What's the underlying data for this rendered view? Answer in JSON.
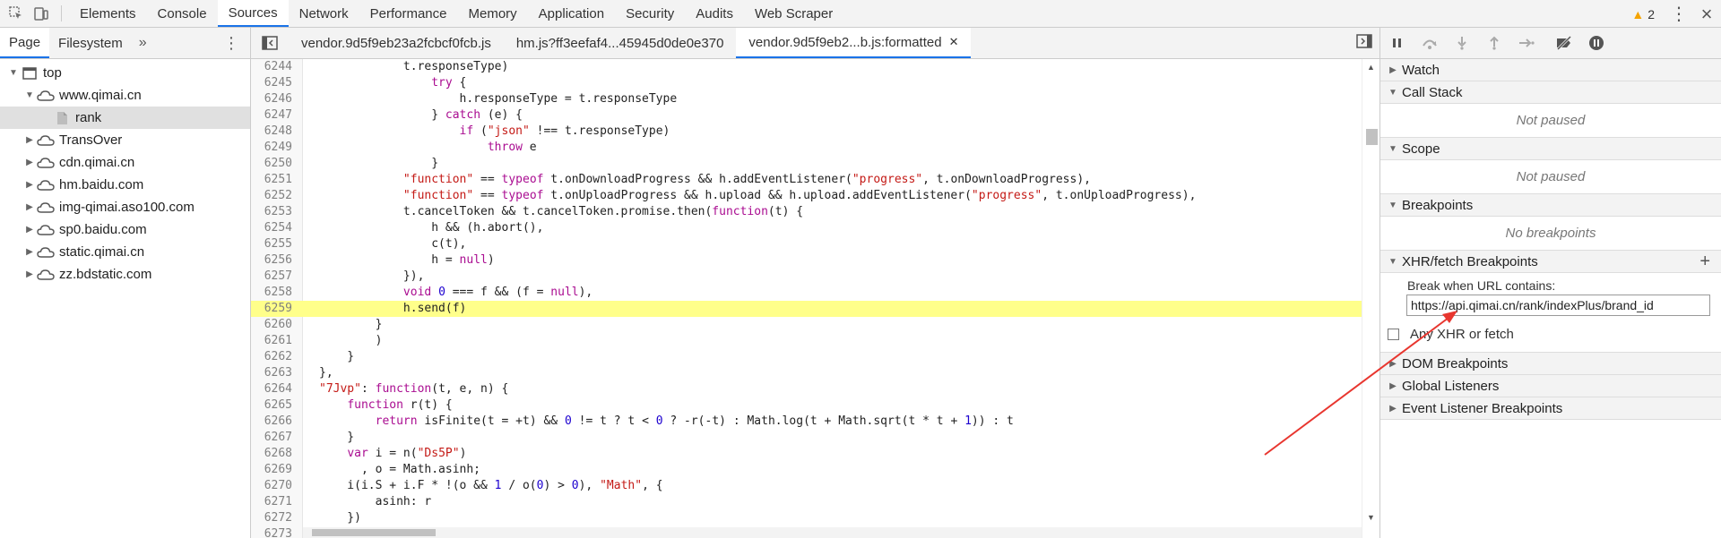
{
  "toolbar": {
    "tabs": [
      "Elements",
      "Console",
      "Sources",
      "Network",
      "Performance",
      "Memory",
      "Application",
      "Security",
      "Audits",
      "Web Scraper"
    ],
    "active_tab": "Sources",
    "warnings_count": "2"
  },
  "navigator": {
    "tabs": [
      "Page",
      "Filesystem"
    ],
    "active_tab": "Page",
    "more": "»",
    "tree": [
      {
        "label": "top",
        "icon": "frame-icon",
        "level": 0,
        "expanded": true
      },
      {
        "label": "www.qimai.cn",
        "icon": "cloud-icon",
        "level": 1,
        "expanded": true
      },
      {
        "label": "rank",
        "icon": "file-icon",
        "level": 2,
        "selected": true
      },
      {
        "label": "TransOver",
        "icon": "cloud-icon",
        "level": 1,
        "expanded": false
      },
      {
        "label": "cdn.qimai.cn",
        "icon": "cloud-icon",
        "level": 1,
        "expanded": false
      },
      {
        "label": "hm.baidu.com",
        "icon": "cloud-icon",
        "level": 1,
        "expanded": false
      },
      {
        "label": "img-qimai.aso100.com",
        "icon": "cloud-icon",
        "level": 1,
        "expanded": false
      },
      {
        "label": "sp0.baidu.com",
        "icon": "cloud-icon",
        "level": 1,
        "expanded": false
      },
      {
        "label": "static.qimai.cn",
        "icon": "cloud-icon",
        "level": 1,
        "expanded": false
      },
      {
        "label": "zz.bdstatic.com",
        "icon": "cloud-icon",
        "level": 1,
        "expanded": false
      }
    ]
  },
  "editor": {
    "tabs": [
      "vendor.9d5f9eb23a2fcbcf0fcb.js",
      "hm.js?ff3eefaf4...45945d0de0e370",
      "vendor.9d5f9eb2...b.js:formatted"
    ],
    "active_tab": "vendor.9d5f9eb2...b.js:formatted",
    "highlighted_line": "6259",
    "lines": [
      {
        "n": "6244",
        "indent": 12,
        "code": "t.responseType)"
      },
      {
        "n": "6245",
        "indent": 16,
        "code": "try {"
      },
      {
        "n": "6246",
        "indent": 20,
        "code": "h.responseType = t.responseType"
      },
      {
        "n": "6247",
        "indent": 16,
        "code": "} catch (e) {"
      },
      {
        "n": "6248",
        "indent": 20,
        "code": "if (\"json\" !== t.responseType)"
      },
      {
        "n": "6249",
        "indent": 24,
        "code": "throw e"
      },
      {
        "n": "6250",
        "indent": 16,
        "code": "}"
      },
      {
        "n": "6251",
        "indent": 12,
        "code": "\"function\" == typeof t.onDownloadProgress && h.addEventListener(\"progress\", t.onDownloadProgress),"
      },
      {
        "n": "6252",
        "indent": 12,
        "code": "\"function\" == typeof t.onUploadProgress && h.upload && h.upload.addEventListener(\"progress\", t.onUploadProgress),"
      },
      {
        "n": "6253",
        "indent": 12,
        "code": "t.cancelToken && t.cancelToken.promise.then(function(t) {"
      },
      {
        "n": "6254",
        "indent": 16,
        "code": "h && (h.abort(),"
      },
      {
        "n": "6255",
        "indent": 16,
        "code": "c(t),"
      },
      {
        "n": "6256",
        "indent": 16,
        "code": "h = null)"
      },
      {
        "n": "6257",
        "indent": 12,
        "code": "}),"
      },
      {
        "n": "6258",
        "indent": 12,
        "code": "void 0 === f && (f = null),"
      },
      {
        "n": "6259",
        "indent": 12,
        "code": "h.send(f)"
      },
      {
        "n": "6260",
        "indent": 8,
        "code": "}"
      },
      {
        "n": "6261",
        "indent": 8,
        "code": ")"
      },
      {
        "n": "6262",
        "indent": 4,
        "code": "}"
      },
      {
        "n": "6263",
        "indent": 0,
        "code": "},"
      },
      {
        "n": "6264",
        "indent": 0,
        "code": "\"7Jvp\": function(t, e, n) {"
      },
      {
        "n": "6265",
        "indent": 4,
        "code": "function r(t) {"
      },
      {
        "n": "6266",
        "indent": 8,
        "code": "return isFinite(t = +t) && 0 != t ? t < 0 ? -r(-t) : Math.log(t + Math.sqrt(t * t + 1)) : t"
      },
      {
        "n": "6267",
        "indent": 4,
        "code": "}"
      },
      {
        "n": "6268",
        "indent": 4,
        "code": "var i = n(\"Ds5P\")"
      },
      {
        "n": "6269",
        "indent": 6,
        "code": ", o = Math.asinh;"
      },
      {
        "n": "6270",
        "indent": 4,
        "code": "i(i.S + i.F * !(o && 1 / o(0) > 0), \"Math\", {"
      },
      {
        "n": "6271",
        "indent": 8,
        "code": "asinh: r"
      },
      {
        "n": "6272",
        "indent": 4,
        "code": "})"
      },
      {
        "n": "6273",
        "indent": 0,
        "code": "},"
      }
    ]
  },
  "debugger": {
    "sections": {
      "watch": "Watch",
      "call_stack": "Call Stack",
      "call_stack_empty": "Not paused",
      "scope": "Scope",
      "scope_empty": "Not paused",
      "breakpoints": "Breakpoints",
      "breakpoints_empty": "No breakpoints",
      "xhr": "XHR/fetch Breakpoints",
      "xhr_label": "Break when URL contains:",
      "xhr_value": "https://api.qimai.cn/rank/indexPlus/brand_id",
      "any_xhr": "Any XHR or fetch",
      "dom": "DOM Breakpoints",
      "global": "Global Listeners",
      "event": "Event Listener Breakpoints"
    }
  },
  "colors": {
    "accent": "#1a73e8",
    "highlight": "#ffff8a",
    "annotation_arrow": "#e8362f"
  }
}
